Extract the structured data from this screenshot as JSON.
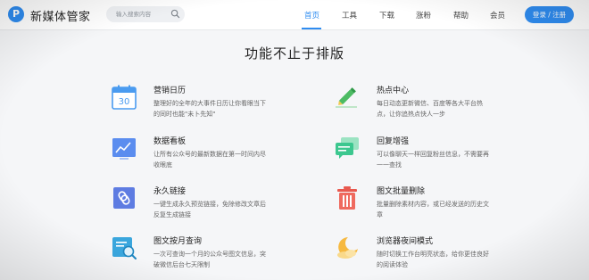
{
  "header": {
    "logo_letter": "P",
    "logo_text": "新媒体管家",
    "search_placeholder": "输入搜索内容",
    "nav": [
      {
        "label": "首页",
        "active": true
      },
      {
        "label": "工具"
      },
      {
        "label": "下载"
      },
      {
        "label": "涨粉"
      },
      {
        "label": "帮助"
      },
      {
        "label": "会员"
      }
    ],
    "login_label": "登录 / 注册",
    "accent_color": "#2f8cf0"
  },
  "main": {
    "heading": "功能不止于排版",
    "features": [
      {
        "icon": "calendar-icon",
        "title": "营销日历",
        "desc": "整理好的全年的大事件日历让你看眼当下的同时也能\"未卜先知\"",
        "calendar_number": "30"
      },
      {
        "icon": "pen-icon",
        "title": "热点中心",
        "desc": "每日动态更新微信、百度等各大平台热点，让你追热点快人一步"
      },
      {
        "icon": "chart-icon",
        "title": "数据看板",
        "desc": "让所有公众号的最新数据在第一时间内尽收眼底"
      },
      {
        "icon": "chat-icon",
        "title": "回复增强",
        "desc": "可以像聊天一样回复粉丝信息，不需要再一一查找"
      },
      {
        "icon": "link-icon",
        "title": "永久链接",
        "desc": "一键生成永久预览链接，免除修改文章后反复生成链接"
      },
      {
        "icon": "trash-icon",
        "title": "图文批量删除",
        "desc": "批量删除素材内容，或已经发送的历史文章"
      },
      {
        "icon": "search-doc-icon",
        "title": "图文按月查询",
        "desc": "一次可查询一个月的公众号图文信息，突破微信后台七天限制"
      },
      {
        "icon": "moon-icon",
        "title": "浏览器夜间模式",
        "desc": "随时切换工作台明亮状态，给你更佳良好的阅读体验"
      }
    ]
  }
}
